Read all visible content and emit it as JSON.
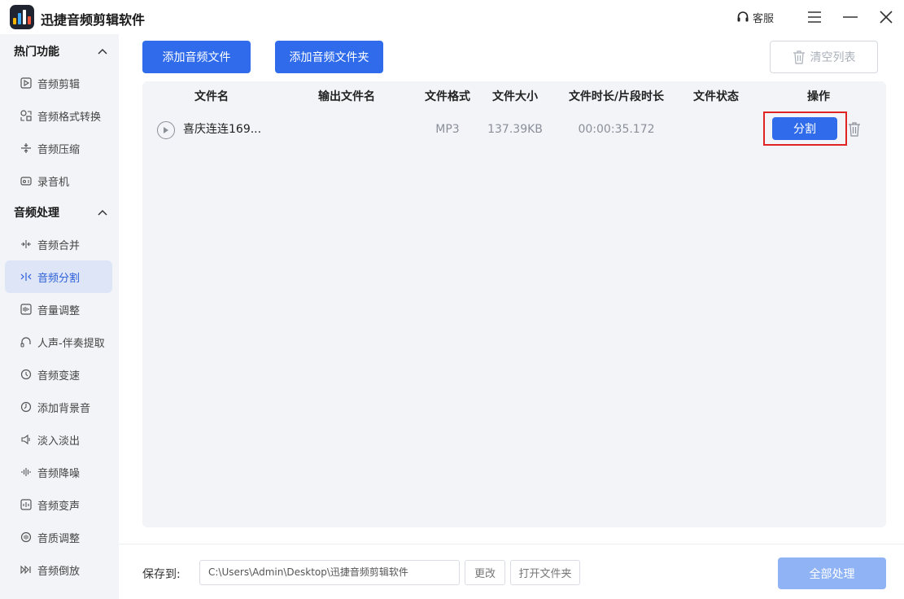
{
  "app": {
    "title": "迅捷音频剪辑软件",
    "support_label": "客服"
  },
  "sidebar": {
    "groups": [
      {
        "title": "热门功能",
        "items": [
          {
            "label": "音频剪辑",
            "icon": "scissors-icon"
          },
          {
            "label": "音频格式转换",
            "icon": "convert-icon"
          },
          {
            "label": "音频压缩",
            "icon": "compress-icon"
          },
          {
            "label": "录音机",
            "icon": "recorder-icon"
          }
        ]
      },
      {
        "title": "音频处理",
        "items": [
          {
            "label": "音频合并",
            "icon": "merge-icon"
          },
          {
            "label": "音频分割",
            "icon": "split-icon",
            "active": true
          },
          {
            "label": "音量调整",
            "icon": "volume-icon"
          },
          {
            "label": "人声-伴奏提取",
            "icon": "headphone-icon"
          },
          {
            "label": "音频变速",
            "icon": "speed-icon"
          },
          {
            "label": "添加背景音",
            "icon": "bgm-icon"
          },
          {
            "label": "淡入淡出",
            "icon": "fade-icon"
          },
          {
            "label": "音频降噪",
            "icon": "denoise-icon"
          },
          {
            "label": "音频变声",
            "icon": "voice-change-icon"
          },
          {
            "label": "音质调整",
            "icon": "quality-icon"
          },
          {
            "label": "音频倒放",
            "icon": "reverse-icon"
          }
        ]
      }
    ]
  },
  "toolbar": {
    "add_file": "添加音频文件",
    "add_folder": "添加音频文件夹",
    "clear_list": "清空列表"
  },
  "table": {
    "headers": [
      "文件名",
      "输出文件名",
      "文件格式",
      "文件大小",
      "文件时长/片段时长",
      "文件状态",
      "操作"
    ],
    "rows": [
      {
        "file_name": "喜庆连连169...",
        "output_name": "",
        "format": "MP3",
        "size": "137.39KB",
        "duration": "00:00:35.172",
        "status": "",
        "action": "分割"
      }
    ]
  },
  "footer": {
    "save_label": "保存到:",
    "save_path": "C:\\Users\\Admin\\Desktop\\迅捷音频剪辑软件",
    "change_label": "更改",
    "open_folder_label": "打开文件夹",
    "process_all_label": "全部处理"
  },
  "colors": {
    "accent": "#2f6bea",
    "accent_disabled": "#8fb3f5",
    "sidebar_bg": "#f3f4f8",
    "active_bg": "#dde5f7",
    "highlight_border": "#e02424"
  }
}
